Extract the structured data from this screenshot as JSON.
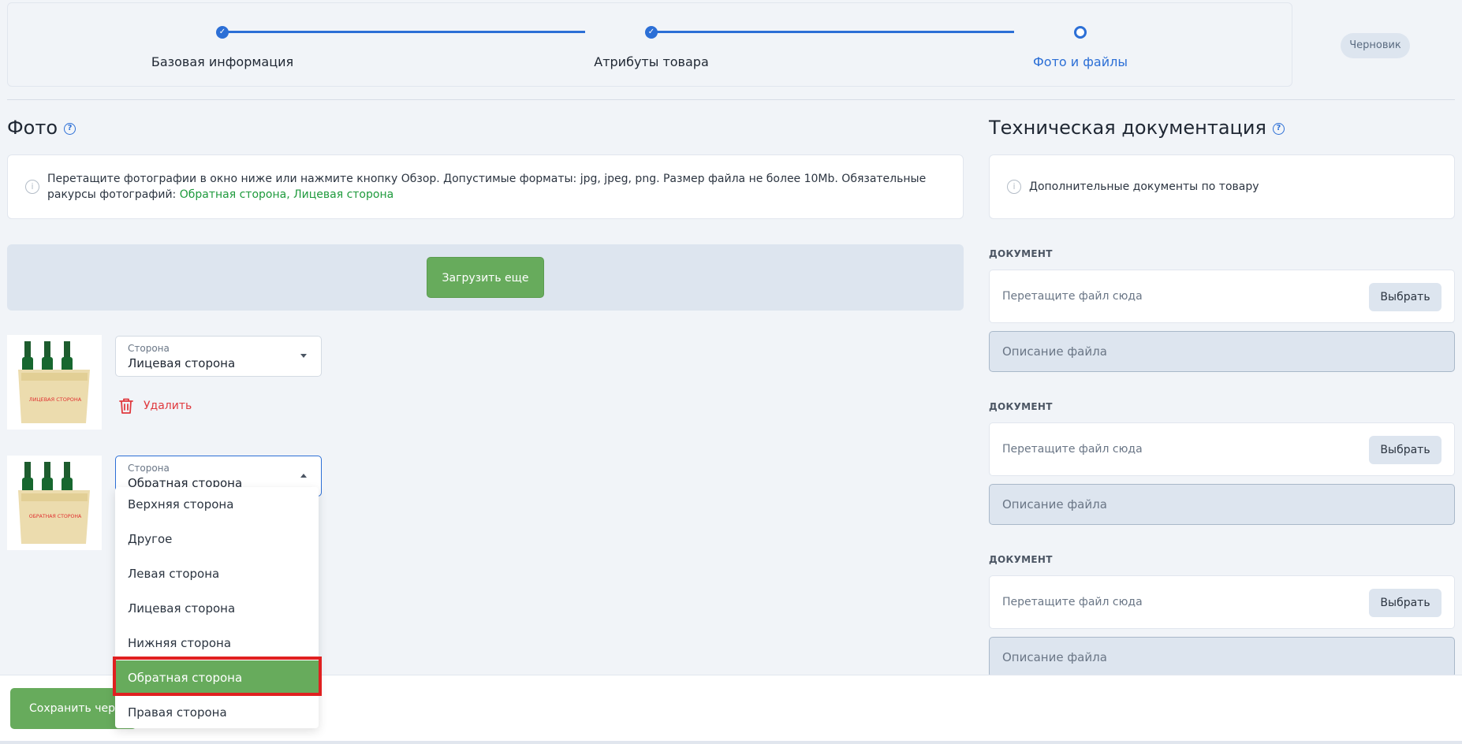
{
  "stepper": {
    "steps": [
      {
        "label": "Базовая информация",
        "state": "done"
      },
      {
        "label": "Атрибуты товара",
        "state": "done"
      },
      {
        "label": "Фото и файлы",
        "state": "current"
      }
    ],
    "status": "Черновик"
  },
  "photo": {
    "title": "Фото",
    "info_text": "Перетащите фотографии в окно ниже или нажмите кнопку Обзор. Допустимые форматы: jpg, jpeg, png. Размер файла не более 10Mb. Обязательные ракурсы фотографий:",
    "required_sides": "Обратная сторона, Лицевая сторона",
    "upload_button": "Загрузить еще",
    "items": [
      {
        "thumb_label": "ЛИЦЕВАЯ СТОРОНА",
        "select_label": "Сторона",
        "select_value": "Лицевая сторона",
        "delete_label": "Удалить"
      },
      {
        "thumb_label": "ОБРАТНАЯ СТОРОНА",
        "select_label": "Сторона",
        "select_value": "Обратная сторона"
      }
    ],
    "dropdown_options": [
      "Верхняя сторона",
      "Другое",
      "Левая сторона",
      "Лицевая сторона",
      "Нижняя сторона",
      "Обратная сторона",
      "Правая сторона"
    ],
    "dropdown_selected": "Обратная сторона"
  },
  "docs": {
    "title": "Техническая документация",
    "info_text": "Дополнительные документы по товару",
    "items": [
      {
        "label": "ДОКУМЕНТ",
        "file_placeholder": "Перетащите файл сюда",
        "choose": "Выбрать",
        "desc_placeholder": "Описание файла"
      },
      {
        "label": "ДОКУМЕНТ",
        "file_placeholder": "Перетащите файл сюда",
        "choose": "Выбрать",
        "desc_placeholder": "Описание файла"
      },
      {
        "label": "ДОКУМЕНТ",
        "file_placeholder": "Перетащите файл сюда",
        "choose": "Выбрать",
        "desc_placeholder": "Описание файла"
      }
    ]
  },
  "footer": {
    "save_button": "Сохранить черновик"
  },
  "colors": {
    "accent": "#2c6fd6",
    "success": "#67ab5c",
    "danger": "#e0393e",
    "highlight": "#e02020"
  }
}
